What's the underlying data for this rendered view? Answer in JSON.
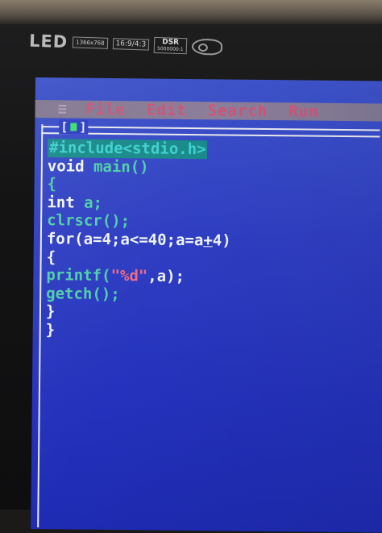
{
  "bezel": {
    "brand": "LED",
    "badge_resolution": "1366x768",
    "badge_ratio": "16:9/4:3",
    "dsr_top": "DSR",
    "dsr_bottom": "5000000:1"
  },
  "menu": {
    "system": "≡",
    "items": [
      "File",
      "Edit",
      "Search",
      "Run"
    ]
  },
  "window": {
    "close_label": "[",
    "close_label_end": "]"
  },
  "code": {
    "lines": [
      {
        "include": "#include<stdio.h>"
      },
      {
        "kw": "void ",
        "id": "main()"
      },
      {
        "plain": "{"
      },
      {
        "kw": "int ",
        "id": "a;"
      },
      {
        "id": "clrscr();"
      },
      {
        "kw": "for(",
        "id": "a=4;a<=40;a=a",
        "underscored": "+",
        "tail": "4)"
      },
      {
        "plain": "{"
      },
      {
        "id": "printf(",
        "str": "\"%d\"",
        "tail": ",a);"
      },
      {
        "id": "getch();"
      },
      {
        "plain": "}"
      },
      {
        "plain": "}"
      }
    ]
  },
  "colors": {
    "screen_bg": "#2f3ec2",
    "menu_bg": "#8e7f86",
    "menu_text": "#e8556a",
    "include_bg": "#1a8a8a",
    "identifier": "#4fcfa8",
    "string": "#ee6a86",
    "close_box": "#3adf6a"
  }
}
